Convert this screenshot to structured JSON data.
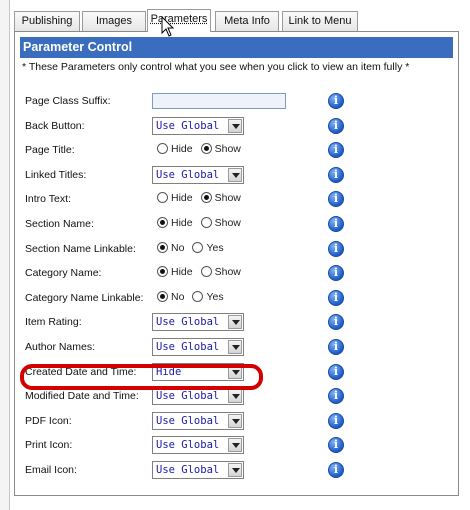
{
  "tabs": [
    {
      "label": "Publishing"
    },
    {
      "label": "Images"
    },
    {
      "label": "Parameters"
    },
    {
      "label": "Meta Info"
    },
    {
      "label": "Link to Menu"
    }
  ],
  "panel": {
    "title": "Parameter Control",
    "note": "* These Parameters only control what you see when you click to view an item fully *",
    "info_glyph": "i"
  },
  "params": [
    {
      "label": "Page Class Suffix:",
      "type": "text",
      "value": ""
    },
    {
      "label": "Back Button:",
      "type": "select",
      "value": "Use Global"
    },
    {
      "label": "Page Title:",
      "type": "radio",
      "options": [
        "Hide",
        "Show"
      ],
      "selected": "Show"
    },
    {
      "label": "Linked Titles:",
      "type": "select",
      "value": "Use Global"
    },
    {
      "label": "Intro Text:",
      "type": "radio",
      "options": [
        "Hide",
        "Show"
      ],
      "selected": "Show"
    },
    {
      "label": "Section Name:",
      "type": "radio",
      "options": [
        "Hide",
        "Show"
      ],
      "selected": "Hide"
    },
    {
      "label": "Section Name Linkable:",
      "type": "radio",
      "options": [
        "No",
        "Yes"
      ],
      "selected": "No"
    },
    {
      "label": "Category Name:",
      "type": "radio",
      "options": [
        "Hide",
        "Show"
      ],
      "selected": "Hide"
    },
    {
      "label": "Category Name Linkable:",
      "type": "radio",
      "options": [
        "No",
        "Yes"
      ],
      "selected": "No"
    },
    {
      "label": "Item Rating:",
      "type": "select",
      "value": "Use Global"
    },
    {
      "label": "Author Names:",
      "type": "select",
      "value": "Use Global"
    },
    {
      "label": "Created Date and Time:",
      "type": "select",
      "value": "Hide"
    },
    {
      "label": "Modified Date and Time:",
      "type": "select",
      "value": "Use Global"
    },
    {
      "label": "PDF Icon:",
      "type": "select",
      "value": "Use Global"
    },
    {
      "label": "Print Icon:",
      "type": "select",
      "value": "Use Global"
    },
    {
      "label": "Email Icon:",
      "type": "select",
      "value": "Use Global"
    }
  ],
  "colors": {
    "header": "#3a6dbe",
    "highlight": "#d40000",
    "select_text": "#1a1aa8",
    "info": "#1d5cc8"
  },
  "icons": {
    "info": "info-icon",
    "cursor": "mouse-pointer-icon",
    "dropdown": "chevron-down-icon"
  }
}
